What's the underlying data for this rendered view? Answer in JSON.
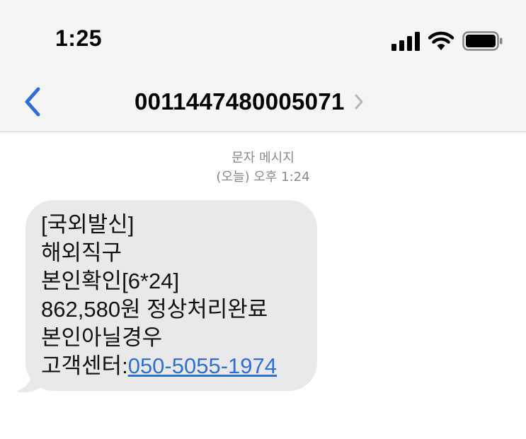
{
  "status_bar": {
    "time": "1:25",
    "icons": [
      "signal-icon",
      "wifi-icon",
      "battery-icon"
    ]
  },
  "nav": {
    "back_icon": "chevron-left-icon",
    "title": "0011447480005071",
    "title_chevron": "chevron-right-icon"
  },
  "conversation": {
    "message_type": "문자 메시지",
    "timestamp": "(오늘) 오후 1:24"
  },
  "message": {
    "lines": [
      "[국외발신]",
      "해외직구",
      "본인확인[6*24]",
      "862,580원 정상처리완료",
      "본인아닐경우"
    ],
    "last_line_prefix": "고객센터:",
    "phone_link": "050-5055-1974"
  },
  "colors": {
    "accent": "#2f6fd6",
    "bubble": "#e9e9eb",
    "header_bg": "#f5f5f5",
    "meta_text": "#8a8a8e"
  }
}
